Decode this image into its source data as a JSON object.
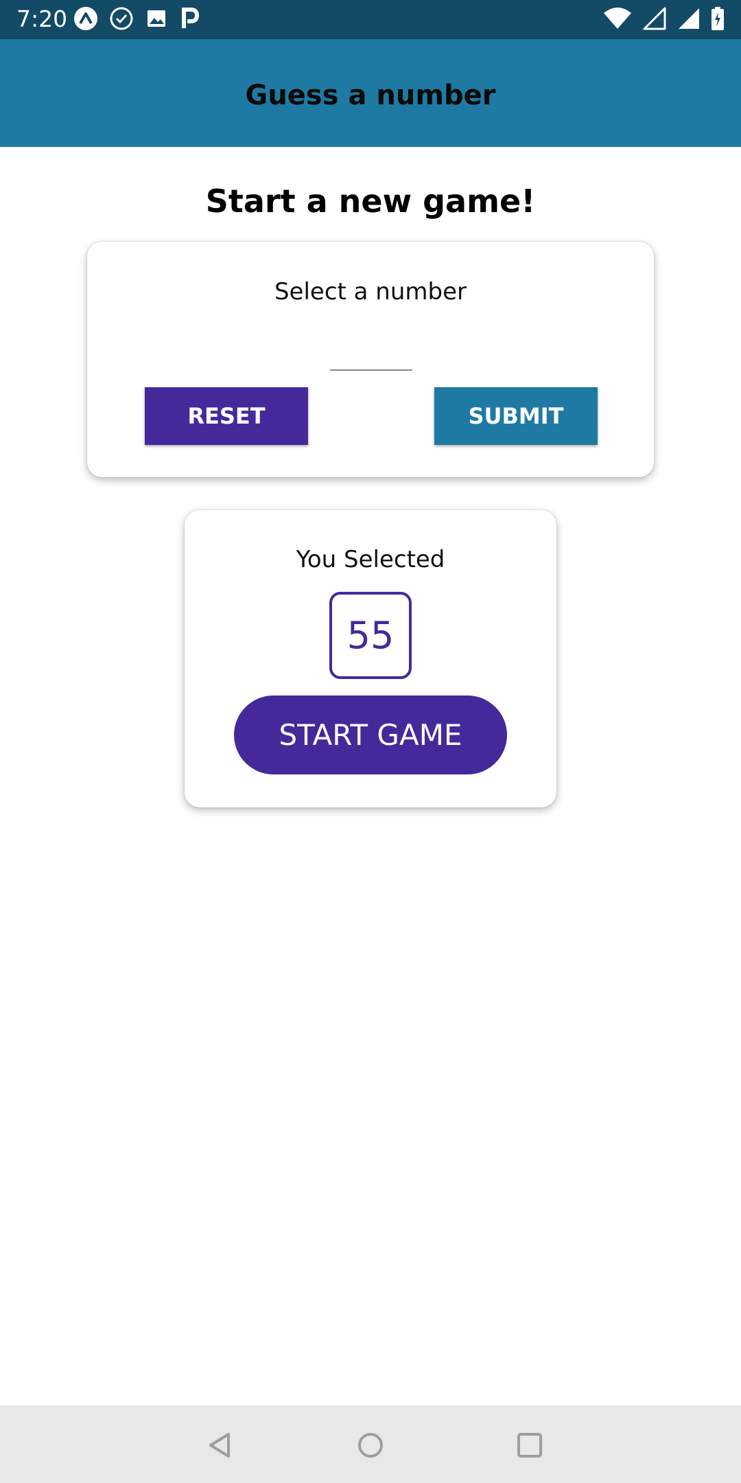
{
  "status_bar": {
    "time": "7:20",
    "left_icons": [
      "expo-icon",
      "check-circle-icon",
      "image-icon",
      "parking-icon"
    ],
    "right_icons": [
      "wifi-icon",
      "signal-empty-icon",
      "signal-icon",
      "battery-charging-icon"
    ]
  },
  "header": {
    "title": "Guess a number",
    "background": "#1e7aa3"
  },
  "page": {
    "title": "Start a new game!"
  },
  "input_card": {
    "label": "Select a number",
    "input_value": "",
    "reset_label": "RESET",
    "submit_label": "SUBMIT"
  },
  "selected_card": {
    "label": "You Selected",
    "number": "55",
    "start_label": "START GAME"
  },
  "colors": {
    "primary": "#45299b",
    "accent": "#1e7aa3",
    "status_bar": "#134a66"
  },
  "nav_bar": {
    "icons": [
      "back-icon",
      "home-icon",
      "recents-icon"
    ]
  }
}
